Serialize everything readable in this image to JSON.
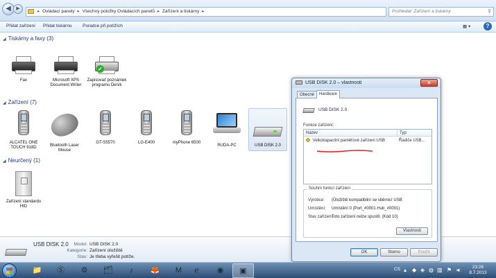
{
  "address": {
    "crumbs": [
      "Ovládací panely",
      "Všechny položky Ovládacích panelů",
      "Zařízení a tiskárny"
    ],
    "search_placeholder": "Prohledat: Zařízení a tiskárny"
  },
  "commands": {
    "add_device": "Přidat zařízení",
    "add_printer": "Přidat tiskárnu",
    "troubleshooter": "Poradce při potížích"
  },
  "groups": {
    "printers": {
      "title": "Tiskárny a faxy (3)",
      "items": [
        "Fax",
        "Microsoft XPS Document Writer",
        "Zapisovač poznámek programu Deník"
      ]
    },
    "devices": {
      "title": "Zařízení (7)",
      "items": [
        "ALCATEL ONE TOUCH 918D",
        "Bluetooth Laser Mouse",
        "GT-S5570",
        "LG-E400",
        "myPhone 6500",
        "RUDA-PC",
        "USB DISK 2.0"
      ]
    },
    "unspecified": {
      "title": "Neurčený (1)",
      "items": [
        "Zařízení standardu HID"
      ]
    }
  },
  "details": {
    "name": "USB DISK 2.0",
    "model_label": "Model:",
    "model_value": "USB DISK 2.0",
    "category_label": "Kategorie:",
    "category_value": "Zařízení úložiště",
    "status_label": "Stav:",
    "status_value": "Je třeba vyřešit potíže."
  },
  "dialog": {
    "title": "USB DISK 2.0 – vlastnosti",
    "tabs": [
      "Obecné",
      "Hardware"
    ],
    "device_name": "USB DISK 2.0",
    "functions_label": "Funkce zařízení:",
    "col_name": "Název",
    "col_type": "Typ",
    "row_name": "Velkokapacitní paměťové zařízení USB",
    "row_type": "Řadiče USB...",
    "summary_legend": "Souhrn funkcí zařízení",
    "manufacturer_label": "Výrobce:",
    "manufacturer_value": "(Ūložiště kompatibilní se sběrnicí USB",
    "location_label": "Umístění:",
    "location_value": "Umístění 0 (Port_#0001.Hub_#0001)",
    "status_label": "Stav zařízení:",
    "status_value": "Toto zařízení nelze spustit. (Kód 10)",
    "properties_button": "Vlastnosti",
    "ok": "OK",
    "cancel": "Storno",
    "apply": "Použít"
  },
  "taskbar": {
    "lang": "CS",
    "time": "23:26",
    "date": "8.7.2013"
  }
}
